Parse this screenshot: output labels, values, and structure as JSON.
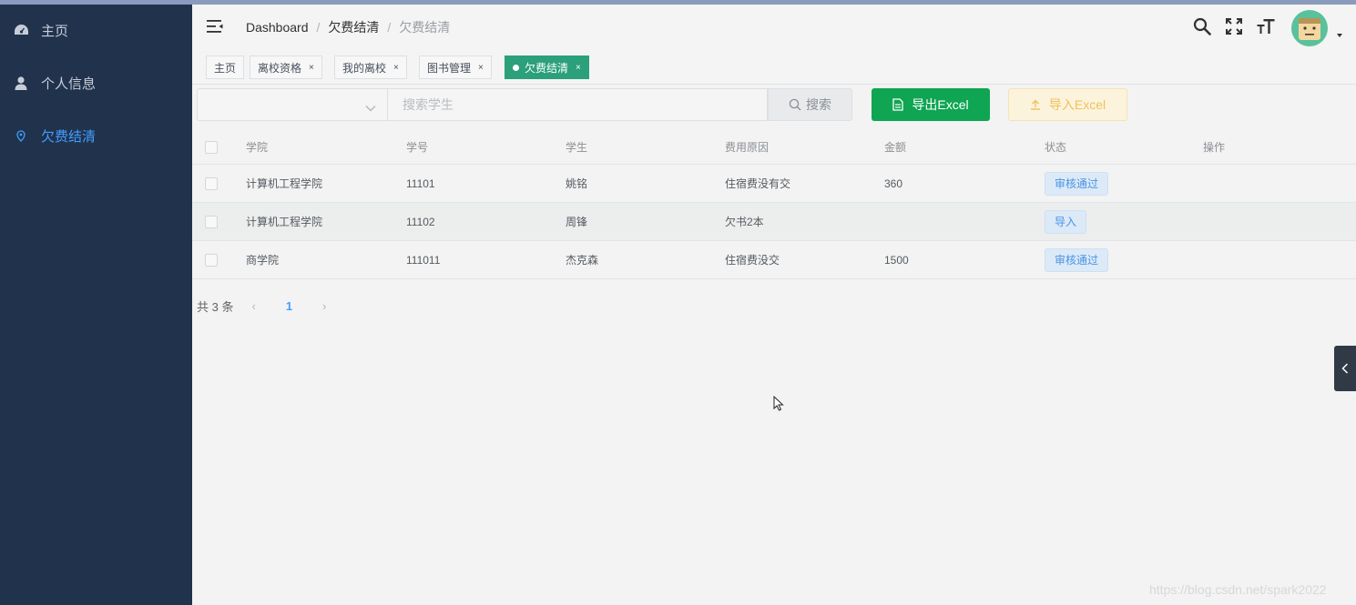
{
  "sidebar": {
    "items": [
      {
        "label": "主页",
        "icon": "dashboard-icon"
      },
      {
        "label": "个人信息",
        "icon": "user-icon"
      },
      {
        "label": "欠费结清",
        "icon": "map-pin-icon",
        "active": true
      }
    ]
  },
  "navbar": {
    "breadcrumb": [
      "Dashboard",
      "欠费结清",
      "欠费结清"
    ],
    "separator": "/"
  },
  "tags": [
    {
      "label": "主页",
      "closable": false
    },
    {
      "label": "离校资格",
      "closable": true
    },
    {
      "label": "我的离校",
      "closable": true
    },
    {
      "label": "图书管理",
      "closable": true
    },
    {
      "label": "欠费结清",
      "closable": true,
      "active": true
    }
  ],
  "tag_close": "×",
  "filter": {
    "select_value": "",
    "search_placeholder": "搜索学生",
    "search_label": "搜索",
    "export_label": "导出Excel",
    "import_label": "导入Excel"
  },
  "table": {
    "columns": [
      "学院",
      "学号",
      "学生",
      "费用原因",
      "金额",
      "状态",
      "操作"
    ],
    "rows": [
      {
        "college": "计算机工程学院",
        "id": "11101",
        "student": "姚铭",
        "reason": "住宿费没有交",
        "amount": "360",
        "status": "审核通过"
      },
      {
        "college": "计算机工程学院",
        "id": "11102",
        "student": "周锋",
        "reason": "欠书2本",
        "amount": "",
        "status": "导入"
      },
      {
        "college": "商学院",
        "id": "111011",
        "student": "杰克森",
        "reason": "住宿费没交",
        "amount": "1500",
        "status": "审核通过"
      }
    ]
  },
  "pagination": {
    "total_text": "共 3 条",
    "current_page": "1",
    "prev": "‹",
    "next": "›"
  },
  "watermark": "https://blog.csdn.net/spark2022",
  "colors": {
    "sidebar_bg": "#21324c",
    "active_menu": "#409eff",
    "active_tag": "#2ba07a",
    "export_button": "#0fa553",
    "import_button_text": "#f0c25a",
    "status_tag_text": "#4994e6"
  }
}
